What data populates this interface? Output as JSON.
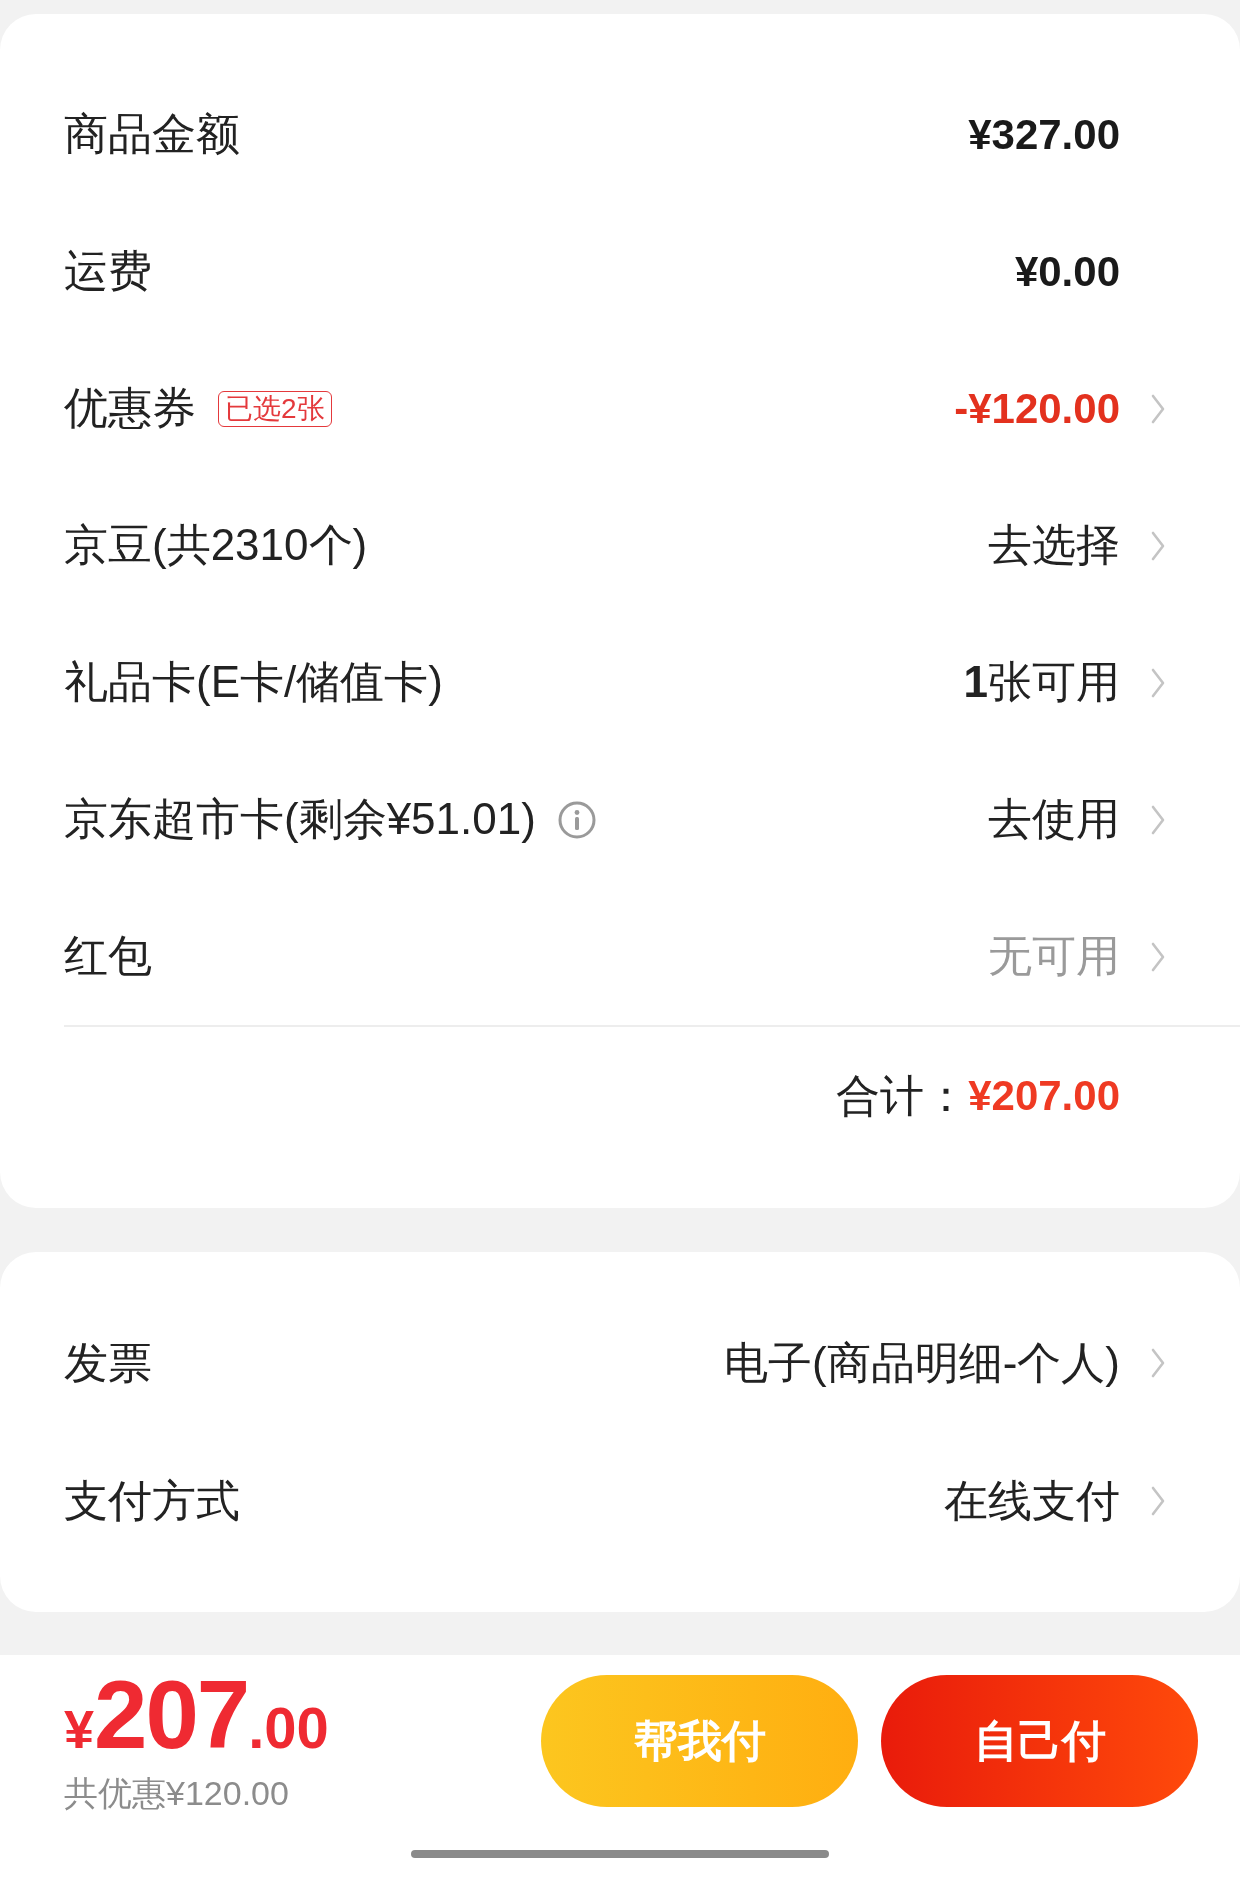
{
  "summary": {
    "rows": [
      {
        "label": "商品金额",
        "value": "¥327.00",
        "kind": "amount",
        "disabled": false,
        "chevron": false
      },
      {
        "label": "运费",
        "value": "¥0.00",
        "kind": "amount",
        "disabled": false,
        "chevron": false
      },
      {
        "label": "优惠券",
        "badge": "已选2张",
        "value": "-¥120.00",
        "kind": "discount",
        "disabled": false,
        "chevron": true
      },
      {
        "label": "京豆(共2310个)",
        "value": "去选择",
        "kind": "text",
        "disabled": false,
        "chevron": true
      },
      {
        "label": "礼品卡(E卡/储值卡)",
        "value": "**1**张可用",
        "kind": "text",
        "disabled": false,
        "chevron": true
      },
      {
        "label": "京东超市卡(剩余¥51.01)",
        "info": true,
        "value": "去使用",
        "kind": "text",
        "disabled": false,
        "chevron": true
      },
      {
        "label": "红包",
        "value": "无可用",
        "kind": "text",
        "disabled": true,
        "chevron": true
      }
    ],
    "total": {
      "label": "合计：",
      "value": "¥207.00"
    }
  },
  "order": {
    "rows": [
      {
        "label": "发票",
        "value": "电子(商品明细-个人)",
        "kind": "text",
        "disabled": false,
        "chevron": true
      },
      {
        "label": "支付方式",
        "value": "在线支付",
        "kind": "text",
        "disabled": false,
        "chevron": true
      }
    ]
  },
  "checkout_bar": {
    "price": {
      "currency": "¥",
      "integer": "207",
      "decimal": ".00"
    },
    "savings": "共优惠¥120.00",
    "buttons": [
      {
        "label": "帮我付",
        "kind": "secondary"
      },
      {
        "label": "自己付",
        "kind": "primary"
      }
    ]
  }
}
